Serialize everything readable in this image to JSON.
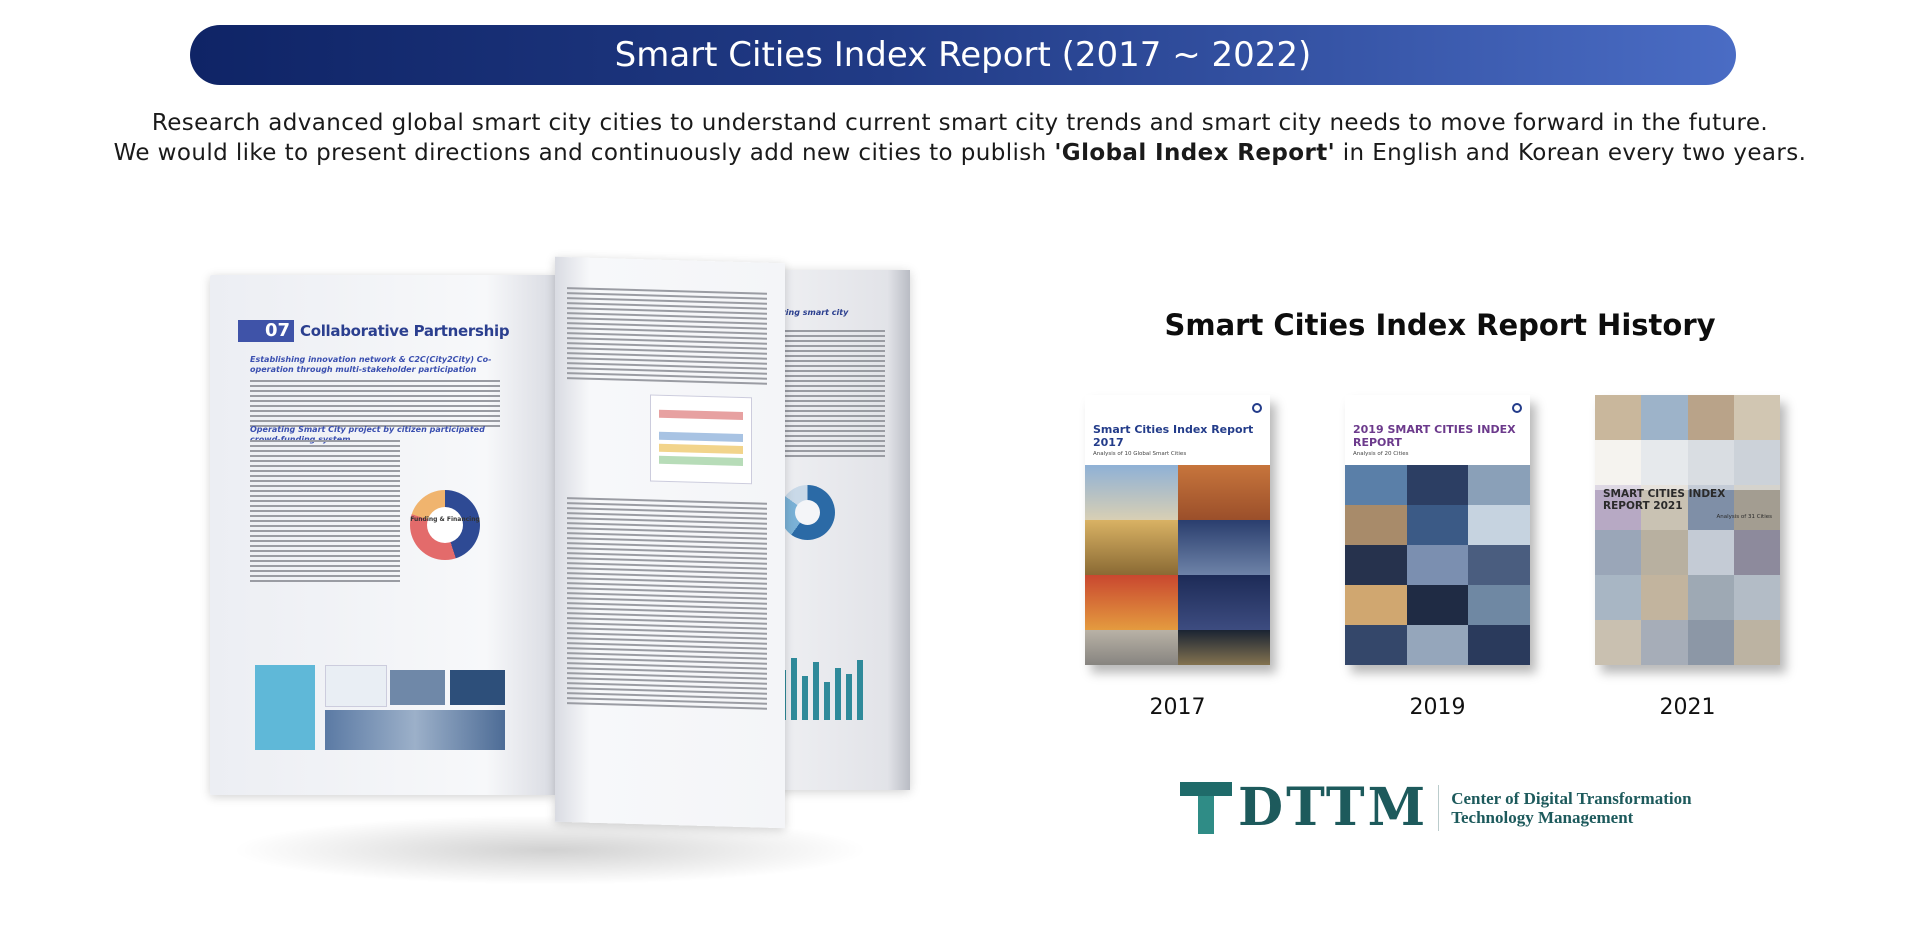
{
  "header": {
    "title": "Smart Cities Index Report (2017 ~ 2022)"
  },
  "intro": {
    "line1": "Research advanced global smart city cities to understand current smart city trends and smart city needs to move forward in the future.",
    "line2_prefix": "We would like to present directions and continuously add new cities to publish ",
    "line2_bold": "'Global Index Report'",
    "line2_suffix": " in English and Korean every two years."
  },
  "book": {
    "chapter_number": "07",
    "chapter_title": "Collaborative Partnership",
    "subheading1": "Establishing innovation network & C2C(City2City) Co-operation through multi-stakeholder participation",
    "subheading2": "Operating Smart City project by citizen participated crowd-funding system",
    "donut_label": "Funding & Financing",
    "back_heading": "dopting smart city"
  },
  "history": {
    "title": "Smart Cities Index Report History",
    "reports": [
      {
        "year": "2017",
        "cover_title": "Smart Cities Index Report 2017",
        "cover_subtitle": "Analysis of 10 Global Smart Cities"
      },
      {
        "year": "2019",
        "cover_title": "2019 SMART CITIES INDEX REPORT",
        "cover_subtitle": "Analysis of 20 Cities"
      },
      {
        "year": "2021",
        "cover_title": "SMART CITIES INDEX REPORT 2021",
        "cover_subtitle": "Analysis of 31 Cities"
      }
    ]
  },
  "logo": {
    "wordmark": "DTTM",
    "org_line1": "Center of Digital Transformation",
    "org_line2": "Technology Management",
    "colors": {
      "teal": "#1d5a5c",
      "teal_light": "#2f8c86"
    }
  },
  "colors": {
    "banner_start": "#0f2466",
    "banner_end": "#4a6cc4"
  }
}
